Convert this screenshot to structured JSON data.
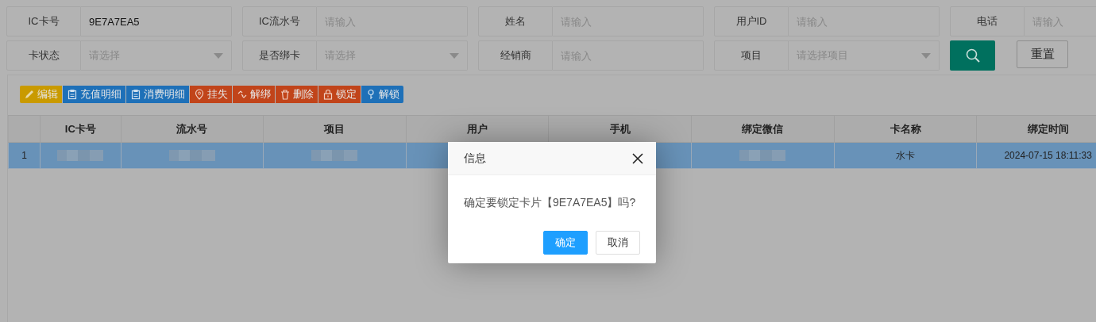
{
  "filters": [
    {
      "label": "IC卡号",
      "kind": "input",
      "value": "9E7A7EA5"
    },
    {
      "label": "IC流水号",
      "kind": "input",
      "placeholder": "请输入"
    },
    {
      "label": "姓名",
      "kind": "input",
      "placeholder": "请输入"
    },
    {
      "label": "用户ID",
      "kind": "input",
      "placeholder": "请输入"
    },
    {
      "label": "电话",
      "kind": "input",
      "placeholder": "请输入"
    },
    {
      "label": "卡状态",
      "kind": "select",
      "placeholder": "请选择"
    },
    {
      "label": "是否绑卡",
      "kind": "select",
      "placeholder": "请选择"
    },
    {
      "label": "经销商",
      "kind": "input",
      "placeholder": "请输入"
    },
    {
      "label": "项目",
      "kind": "select",
      "placeholder": "请选择项目"
    }
  ],
  "reset_button": "重置",
  "toolbar": [
    {
      "label": "编辑",
      "kind": "warning"
    },
    {
      "label": "充值明细",
      "kind": "normal"
    },
    {
      "label": "消费明细",
      "kind": "normal"
    },
    {
      "label": "挂失",
      "kind": "danger"
    },
    {
      "label": "解绑",
      "kind": "danger"
    },
    {
      "label": "删除",
      "kind": "danger"
    },
    {
      "label": "锁定",
      "kind": "danger"
    },
    {
      "label": "解锁",
      "kind": "normal"
    }
  ],
  "table": {
    "columns": [
      "",
      "IC卡号",
      "流水号",
      "项目",
      "用户",
      "手机",
      "绑定微信",
      "卡名称",
      "绑定时间"
    ],
    "rows": [
      {
        "selected": true,
        "cells": [
          {
            "kind": "text",
            "text": "1"
          },
          {
            "kind": "redacted"
          },
          {
            "kind": "redacted"
          },
          {
            "kind": "redacted"
          },
          {
            "kind": "empty"
          },
          {
            "kind": "empty"
          },
          {
            "kind": "redacted"
          },
          {
            "kind": "text",
            "text": "水卡"
          },
          {
            "kind": "text",
            "text": "2024-07-15 18:11:33"
          }
        ]
      }
    ]
  },
  "dialog": {
    "title": "信息",
    "message": "确定要锁定卡片【9E7A7EA5】吗?",
    "buttons": [
      {
        "label": "确定",
        "primary": true
      },
      {
        "label": "取消",
        "primary": false
      }
    ]
  }
}
